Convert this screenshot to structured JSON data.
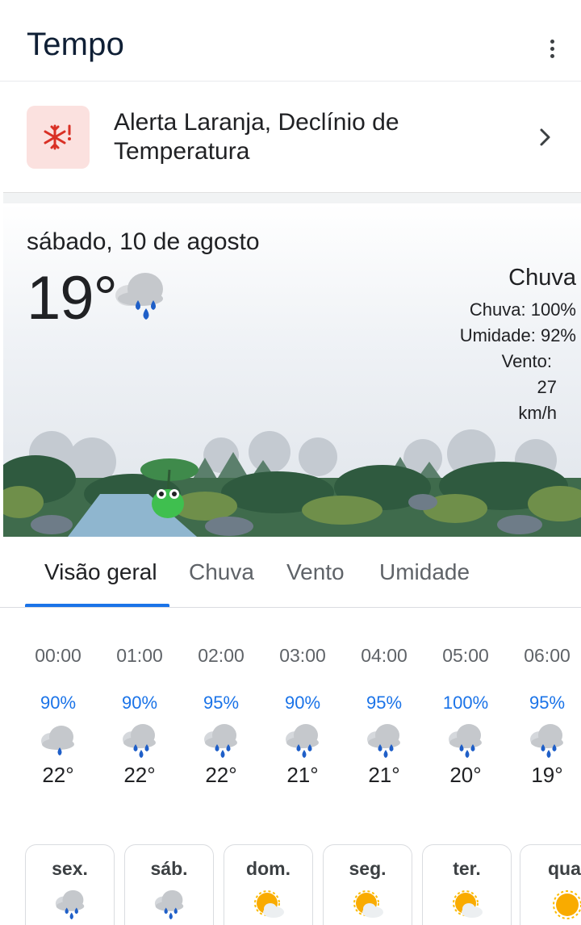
{
  "header": {
    "title": "Tempo",
    "menu_icon": "more-vert-icon"
  },
  "alert": {
    "text": "Alerta Laranja, Declínio de Temperatura",
    "icon": "snowflake-alert-icon",
    "icon_color": "#d93025",
    "bg_color": "#fbe1df"
  },
  "current": {
    "date": "sábado, 10 de agosto",
    "temp": "19°",
    "condition": "Chuva",
    "precip": "Chuva: 100%",
    "humidity": "Umidade: 92%",
    "wind_label": "Vento:",
    "wind_value": "27",
    "wind_unit": "km/h",
    "icon": "rain-heavy-icon"
  },
  "tabs": [
    {
      "label": "Visão geral",
      "active": true
    },
    {
      "label": "Chuva",
      "active": false
    },
    {
      "label": "Vento",
      "active": false
    },
    {
      "label": "Umidade",
      "active": false
    }
  ],
  "hourly": [
    {
      "time": "00:00",
      "precip": "90%",
      "temp": "22°",
      "icon": "rain-light-icon"
    },
    {
      "time": "01:00",
      "precip": "90%",
      "temp": "22°",
      "icon": "rain-heavy-icon"
    },
    {
      "time": "02:00",
      "precip": "95%",
      "temp": "22°",
      "icon": "rain-heavy-icon"
    },
    {
      "time": "03:00",
      "precip": "90%",
      "temp": "21°",
      "icon": "rain-heavy-icon"
    },
    {
      "time": "04:00",
      "precip": "95%",
      "temp": "21°",
      "icon": "rain-heavy-icon"
    },
    {
      "time": "05:00",
      "precip": "100%",
      "temp": "20°",
      "icon": "rain-heavy-icon"
    },
    {
      "time": "06:00",
      "precip": "95%",
      "temp": "19°",
      "icon": "rain-heavy-icon"
    }
  ],
  "daily": [
    {
      "day": "sex.",
      "icon": "rain-heavy-icon"
    },
    {
      "day": "sáb.",
      "icon": "rain-heavy-icon"
    },
    {
      "day": "dom.",
      "icon": "partly-cloudy-icon"
    },
    {
      "day": "seg.",
      "icon": "partly-cloudy-icon"
    },
    {
      "day": "ter.",
      "icon": "partly-cloudy-icon"
    },
    {
      "day": "qua",
      "icon": "sun-icon"
    }
  ],
  "colors": {
    "accent": "#1a73e8",
    "precip_text": "#1a73e8",
    "rain_drop": "#1f5fc8",
    "sun": "#f9ab00"
  }
}
